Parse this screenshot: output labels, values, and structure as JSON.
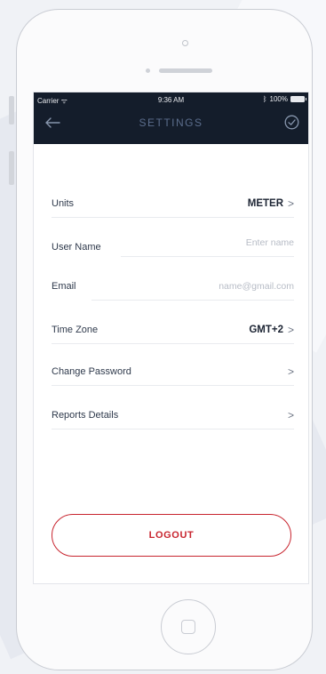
{
  "status_bar": {
    "carrier": "Carrier ᯤ",
    "time": "9:36 AM",
    "battery": "100%"
  },
  "navbar": {
    "title": "SETTINGS",
    "back_icon": "back-arrow-icon",
    "confirm_icon": "check-circle-icon"
  },
  "settings": {
    "units": {
      "label": "Units",
      "value": "METER",
      "chevron": ">"
    },
    "user_name": {
      "label": "User Name",
      "placeholder": "Enter name"
    },
    "email": {
      "label": "Email",
      "placeholder": "name@gmail.com"
    },
    "time_zone": {
      "label": "Time Zone",
      "value": "GMT+2",
      "chevron": ">"
    },
    "change_password": {
      "label": "Change Password",
      "chevron": ">"
    },
    "reports_details": {
      "label": "Reports Details",
      "chevron": ">"
    }
  },
  "logout_label": "LOGOUT",
  "colors": {
    "navbar_bg": "#141d2b",
    "title_color": "#5b6d8c",
    "accent_red": "#c8252f"
  }
}
